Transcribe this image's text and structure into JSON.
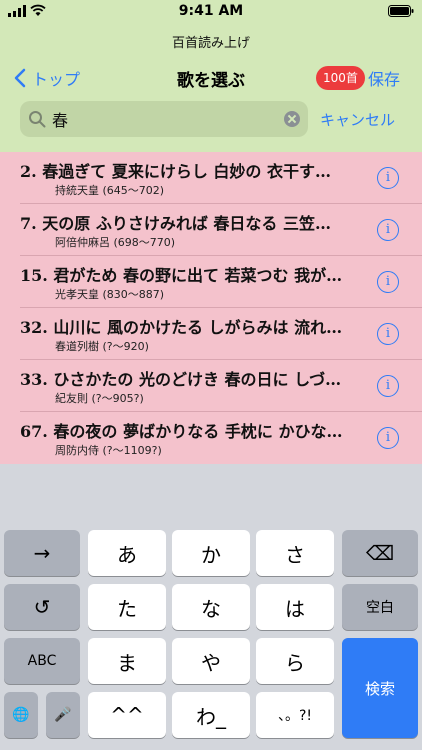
{
  "status_bar": {
    "time": "9:41 AM"
  },
  "app": {
    "title": "百首読み上げ"
  },
  "nav": {
    "back_label": "トップ",
    "title": "歌を選ぶ",
    "badge": "100首",
    "save_label": "保存"
  },
  "search": {
    "value": "春",
    "cancel_label": "キャンセル"
  },
  "colors": {
    "accent": "#2f7cf6",
    "header_bg": "#d3e8b8",
    "list_bg": "#f4c2cc",
    "badge_bg": "#ec3b3d"
  },
  "poems": [
    {
      "text": "2. 春過ぎて 夏来にけらし 白妙の 衣干す…",
      "author": "持統天皇 (645〜702)"
    },
    {
      "text": "7. 天の原 ふりさけみれば 春日なる 三笠…",
      "author": "阿倍仲麻呂 (698〜770)"
    },
    {
      "text": "15. 君がため 春の野に出て 若菜つむ 我が…",
      "author": "光孝天皇 (830〜887)"
    },
    {
      "text": "32. 山川に 風のかけたる しがらみは 流れ…",
      "author": "春道列樹 (?〜920)"
    },
    {
      "text": "33. ひさかたの 光のどけき 春の日に しづ…",
      "author": "紀友則 (?〜905?)"
    },
    {
      "text": "67. 春の夜の 夢ばかりなる 手枕に かひな…",
      "author": "周防内侍 (?〜1109?)"
    }
  ],
  "keyboard": {
    "row1": [
      "→",
      "あ",
      "か",
      "さ",
      "⌫"
    ],
    "row2": [
      "↺",
      "た",
      "な",
      "は",
      "空白"
    ],
    "row3": [
      "ABC",
      "ま",
      "や",
      "ら",
      "検索"
    ],
    "row4": [
      "🌐",
      "🎤",
      "^^",
      "わ_",
      "、。?!"
    ]
  }
}
